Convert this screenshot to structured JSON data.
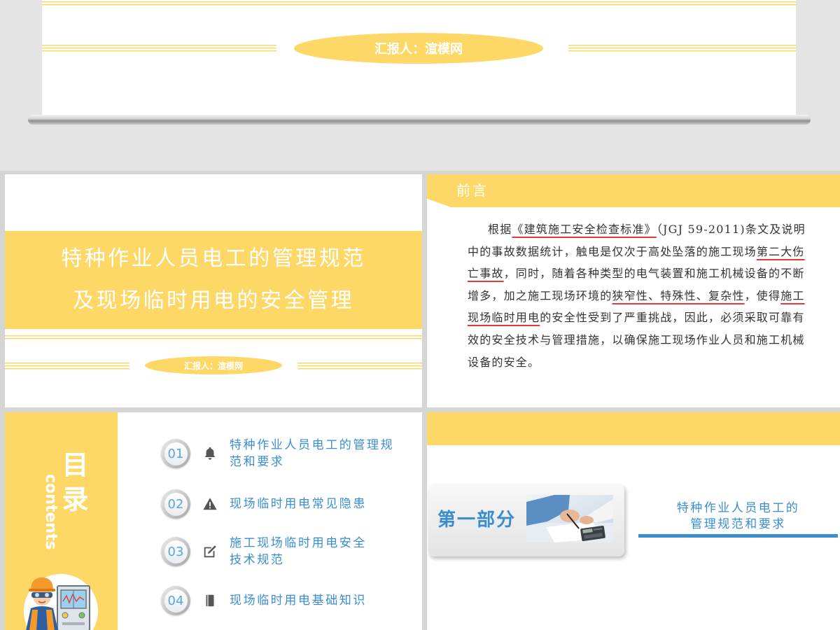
{
  "colors": {
    "accent_yellow": "#fdd866",
    "accent_blue": "#3a8ed0",
    "highlight_underline": "#e53935",
    "body_text": "#333333",
    "icon_gray": "#555555"
  },
  "top_slide": {
    "reporter": "汇报人：渲模网"
  },
  "cover_slide": {
    "title_lines": [
      "特种作业人员电工的管理规范",
      "及现场临时用电的安全管理"
    ],
    "reporter": "汇报人：渲模网"
  },
  "preface_slide": {
    "heading": "前言",
    "lines": [
      [
        {
          "text": "根据",
          "underline": false
        },
        {
          "text": "《建筑施工安全检查标准》",
          "underline": true
        },
        {
          "text": "（JGJ 59-2011)条文及说明",
          "underline": false
        }
      ],
      [
        {
          "text": "中的事故数据统计，触电是仅次于高处坠落的施工现场",
          "underline": false
        },
        {
          "text": "第二大伤",
          "underline": true
        }
      ],
      [
        {
          "text": "亡事故",
          "underline": true
        },
        {
          "text": "，同时，随着各种类型的电气装置和施工机械设备的不断",
          "underline": false
        }
      ],
      [
        {
          "text": "增多，加之施工现场环境的",
          "underline": false
        },
        {
          "text": "狭窄性、特殊性、复杂性",
          "underline": true
        },
        {
          "text": "，使得",
          "underline": false
        },
        {
          "text": "施工",
          "underline": true
        }
      ],
      [
        {
          "text": "现场临时用电",
          "underline": true
        },
        {
          "text": "的安全性受到了严重挑战，因此，必须采取可靠有",
          "underline": false
        }
      ],
      [
        {
          "text": "效的安全技术与管理措施，以确保施工现场作业人员和施工机械",
          "underline": false
        }
      ],
      [
        {
          "text": "设备的安全。",
          "underline": false
        }
      ]
    ]
  },
  "toc_slide": {
    "title": "目录",
    "subtitle": "contents",
    "illustration": "electrician-with-cabinet-illustration",
    "items": [
      {
        "number": "01",
        "icon": "bell-icon",
        "lines": [
          "特种作业人员电工的管理规",
          "范和要求"
        ]
      },
      {
        "number": "02",
        "icon": "warning-icon",
        "lines": [
          "现场临时用电常见隐患"
        ]
      },
      {
        "number": "03",
        "icon": "edit-icon",
        "lines": [
          "施工现场临时用电安全",
          "技术规范"
        ]
      },
      {
        "number": "04",
        "icon": "book-icon",
        "lines": [
          "现场临时用电基础知识"
        ]
      }
    ]
  },
  "section_slide": {
    "label": "第一部分",
    "photo": "hands-with-calculator-photo",
    "title_lines": [
      "特种作业人员电工的",
      "管理规范和要求"
    ]
  }
}
